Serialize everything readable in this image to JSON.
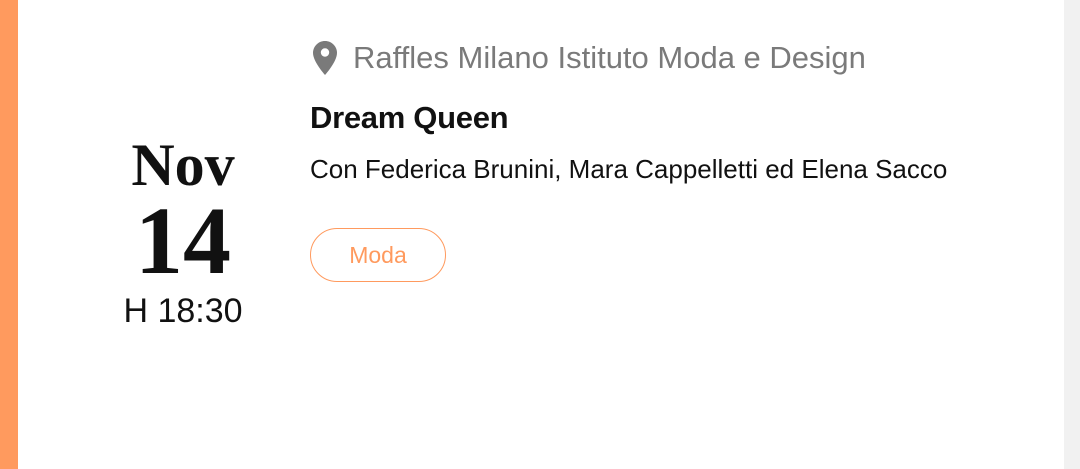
{
  "colors": {
    "accent": "#ff9a5e",
    "location_text": "#7a7a7a",
    "text_primary": "#111111"
  },
  "event": {
    "date": {
      "month": "Nov",
      "day": "14",
      "time": "H 18:30"
    },
    "location": {
      "icon": "map-pin-icon",
      "name": "Raffles Milano Istituto Moda e Design"
    },
    "title": "Dream Queen",
    "subtitle": "Con Federica Brunini, Mara Cappelletti ed Elena Sacco",
    "tag": "Moda"
  }
}
